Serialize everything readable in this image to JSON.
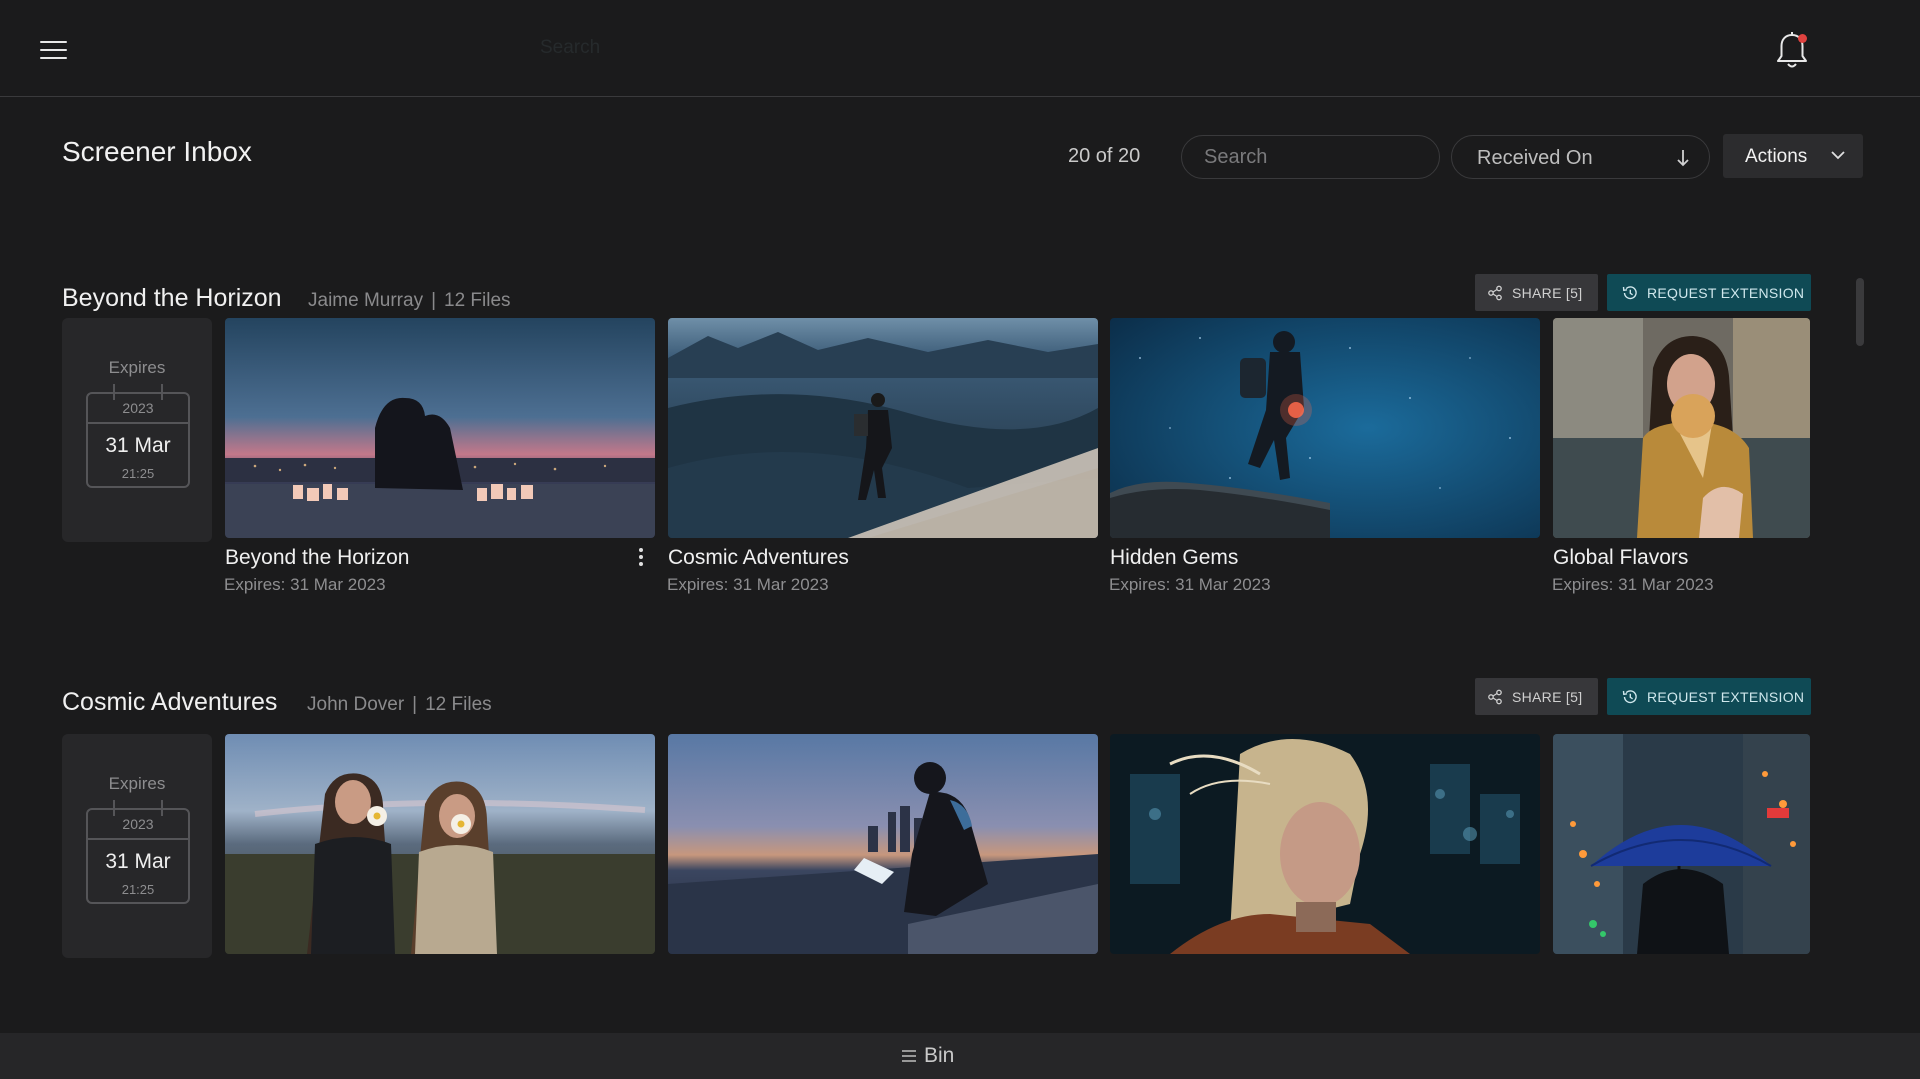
{
  "topbar": {
    "menu_icon": "hamburger-icon",
    "search_placeholder": "Search",
    "bell_icon": "bell-icon",
    "notification_dot_color": "#e0423f"
  },
  "header": {
    "title": "Screener Inbox",
    "count": "20 of 20",
    "search_placeholder": "Search",
    "sort_label": "Received On",
    "sort_icon": "arrow-down-icon",
    "actions_label": "Actions",
    "actions_icon": "chevron-down-icon"
  },
  "sections": [
    {
      "title": "Beyond the Horizon",
      "owner": "Jaime Murray",
      "separator": "|",
      "files": "12 Files",
      "share_label": "SHARE [5]",
      "extension_label": "REQUEST EXTENSION",
      "expiry": {
        "label": "Expires",
        "year": "2023",
        "date": "31 Mar",
        "time": "21:25"
      },
      "cards": [
        {
          "title": "Beyond the Horizon",
          "expires": "Expires: 31 Mar 2023",
          "image": "couple-sunset-city"
        },
        {
          "title": "Cosmic Adventures",
          "expires": "Expires: 31 Mar 2023",
          "image": "hiker-desert-dunes"
        },
        {
          "title": "Hidden Gems",
          "expires": "Expires: 31 Mar 2023",
          "image": "hiker-night-sky"
        },
        {
          "title": "Global Flavors",
          "expires": "Expires: 31 Mar 2023",
          "image": "woman-ice-cream"
        }
      ]
    },
    {
      "title": "Cosmic Adventures",
      "owner": "John Dover",
      "separator": "|",
      "files": "12 Files",
      "share_label": "SHARE [5]",
      "extension_label": "REQUEST EXTENSION",
      "expiry": {
        "label": "Expires",
        "year": "2023",
        "date": "31 Mar",
        "time": "21:25"
      },
      "cards": [
        {
          "image": "women-flowers-field"
        },
        {
          "image": "man-laptop-city-dusk"
        },
        {
          "image": "woman-wind-hair"
        },
        {
          "image": "blue-umbrella-street"
        }
      ]
    }
  ],
  "colors": {
    "background": "#1b1b1c",
    "accent_teal": "#0f4a55",
    "panel": "#272729"
  },
  "footer": {
    "bin_label": "Bin",
    "bin_icon": "list-icon"
  }
}
